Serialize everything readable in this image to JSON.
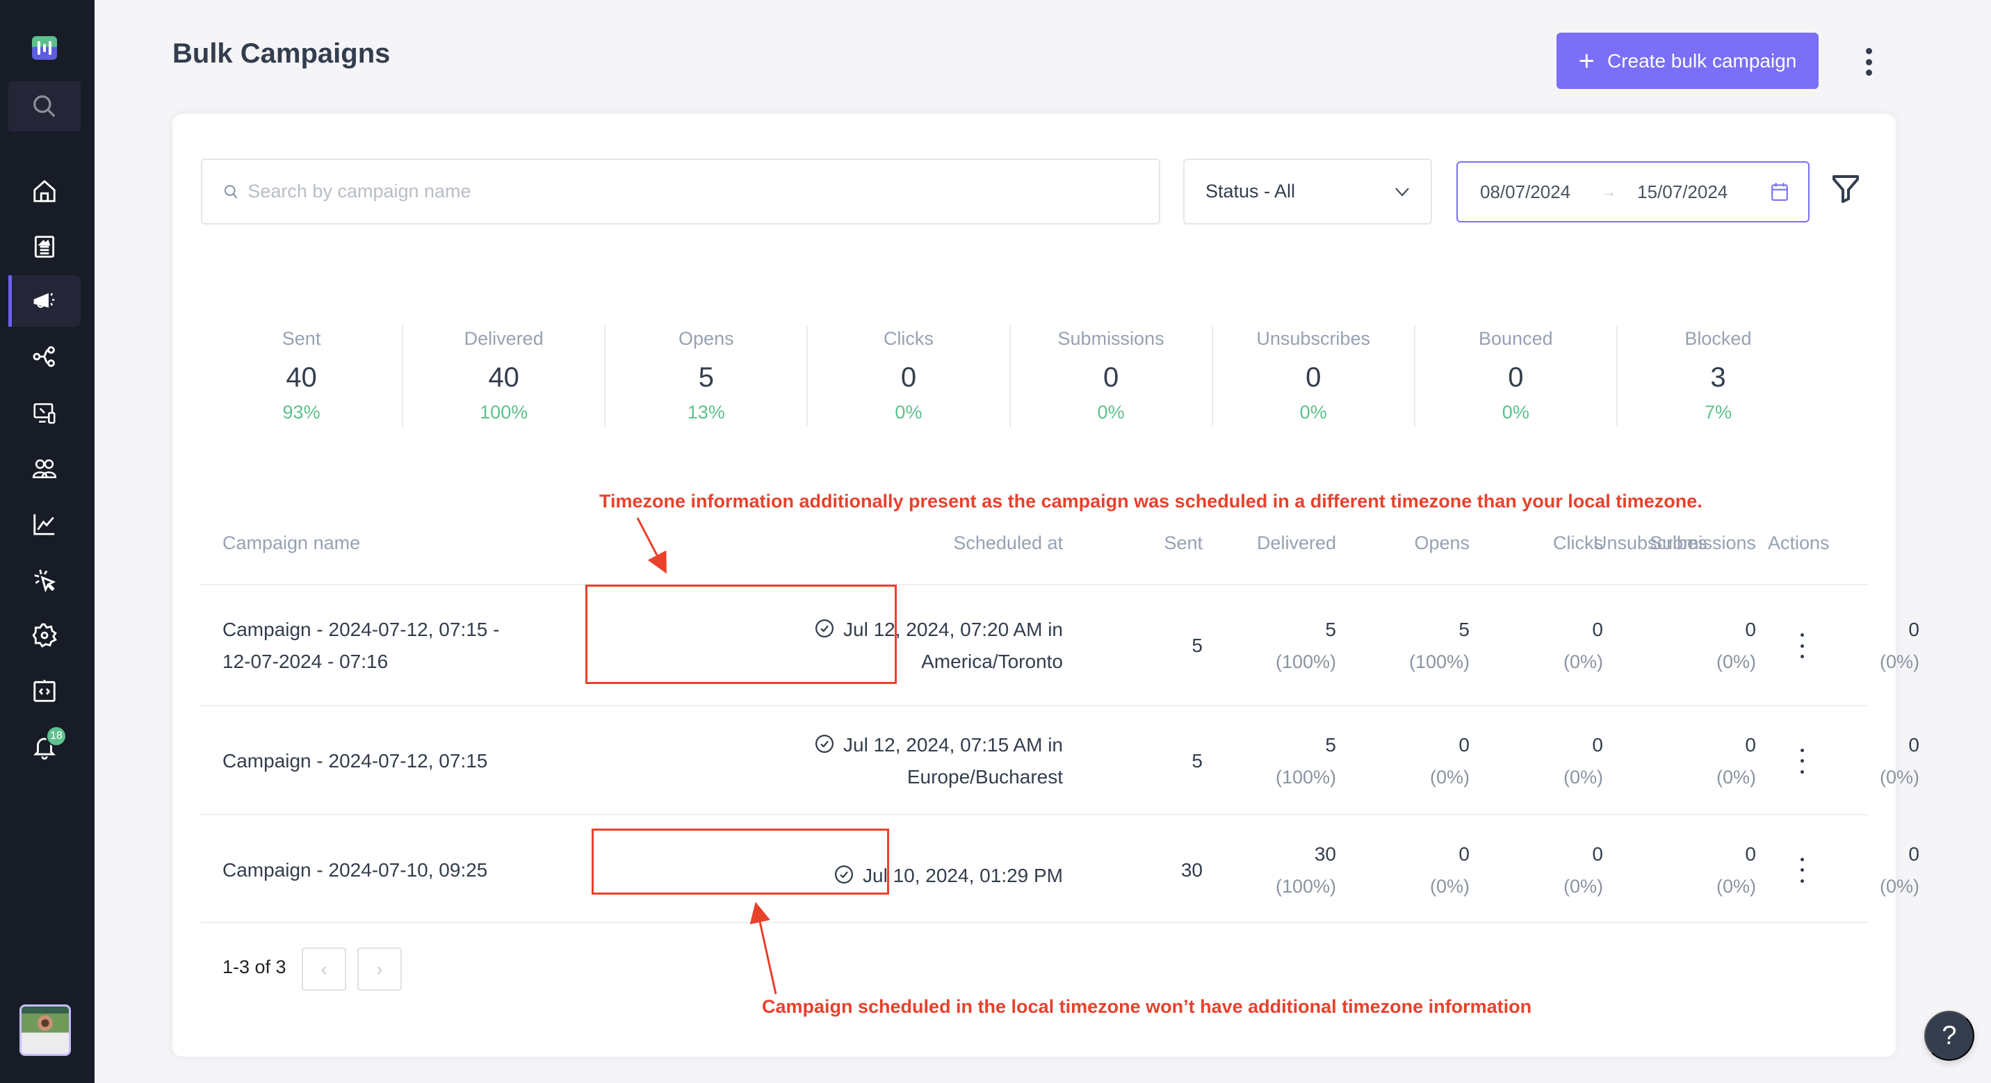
{
  "app": {
    "notification_count": "18"
  },
  "sidebar": {
    "items": [
      {
        "name": "home",
        "icon": "home-icon"
      },
      {
        "name": "forms",
        "icon": "form-icon"
      },
      {
        "name": "campaigns",
        "icon": "megaphone-icon",
        "active": true
      },
      {
        "name": "workflows",
        "icon": "share-nodes-icon"
      },
      {
        "name": "web-pages",
        "icon": "devices-icon"
      },
      {
        "name": "contacts",
        "icon": "users-icon"
      },
      {
        "name": "analytics",
        "icon": "chart-line-icon"
      },
      {
        "name": "tracking",
        "icon": "cursor-click-icon"
      },
      {
        "name": "settings",
        "icon": "gear-icon"
      },
      {
        "name": "integrations",
        "icon": "code-icon"
      },
      {
        "name": "notifications",
        "icon": "bell-icon"
      }
    ]
  },
  "header": {
    "title": "Bulk Campaigns",
    "create_button": "Create bulk campaign"
  },
  "filters": {
    "search_placeholder": "Search by campaign name",
    "search_value": "",
    "status_value": "Status - All",
    "date_from": "08/07/2024",
    "date_to": "15/07/2024"
  },
  "stats": [
    {
      "label": "Sent",
      "value": "40",
      "pct": "93%"
    },
    {
      "label": "Delivered",
      "value": "40",
      "pct": "100%"
    },
    {
      "label": "Opens",
      "value": "5",
      "pct": "13%"
    },
    {
      "label": "Clicks",
      "value": "0",
      "pct": "0%"
    },
    {
      "label": "Submissions",
      "value": "0",
      "pct": "0%"
    },
    {
      "label": "Unsubscribes",
      "value": "0",
      "pct": "0%"
    },
    {
      "label": "Bounced",
      "value": "0",
      "pct": "0%"
    },
    {
      "label": "Blocked",
      "value": "3",
      "pct": "7%"
    }
  ],
  "table": {
    "columns": [
      "Campaign name",
      "Scheduled at",
      "Sent",
      "Delivered",
      "Opens",
      "Clicks",
      "Submissions",
      "Unsubscribes",
      "Actions"
    ],
    "rows": [
      {
        "name_line1": "Campaign - 2024-07-12, 07:15 -",
        "name_line2": "12-07-2024 - 07:16",
        "sched_line1": "Jul 12, 2024, 07:20 AM in",
        "sched_line2": "America/Toronto",
        "sent": "5",
        "delivered": "5",
        "delivered_pct": "(100%)",
        "opens": "5",
        "opens_pct": "(100%)",
        "clicks": "0",
        "clicks_pct": "(0%)",
        "submissions": "0",
        "submissions_pct": "(0%)",
        "unsubscribes": "0",
        "unsubscribes_pct": "(0%)"
      },
      {
        "name_line1": "Campaign - 2024-07-12, 07:15",
        "name_line2": "",
        "sched_line1": "Jul 12, 2024, 07:15 AM in",
        "sched_line2": "Europe/Bucharest",
        "sent": "5",
        "delivered": "5",
        "delivered_pct": "(100%)",
        "opens": "0",
        "opens_pct": "(0%)",
        "clicks": "0",
        "clicks_pct": "(0%)",
        "submissions": "0",
        "submissions_pct": "(0%)",
        "unsubscribes": "0",
        "unsubscribes_pct": "(0%)"
      },
      {
        "name_line1": "Campaign - 2024-07-10, 09:25",
        "name_line2": "",
        "sched_line1": "Jul 10, 2024, 01:29 PM",
        "sched_line2": "",
        "sent": "30",
        "delivered": "30",
        "delivered_pct": "(100%)",
        "opens": "0",
        "opens_pct": "(0%)",
        "clicks": "0",
        "clicks_pct": "(0%)",
        "submissions": "0",
        "submissions_pct": "(0%)",
        "unsubscribes": "0",
        "unsubscribes_pct": "(0%)"
      }
    ]
  },
  "pagination": {
    "summary": "1-3 of 3",
    "prev": "‹",
    "next": "›"
  },
  "annotations": {
    "top": "Timezone information additionally present as the campaign was scheduled in a different timezone than your local timezone.",
    "bottom": "Campaign scheduled in the local timezone won’t have additional timezone information"
  },
  "help": {
    "label": "?"
  },
  "colors": {
    "accent": "#7a6ff5",
    "positive": "#5ec18d",
    "annotation": "#e8412c",
    "sidebar_bg": "#171c27"
  }
}
